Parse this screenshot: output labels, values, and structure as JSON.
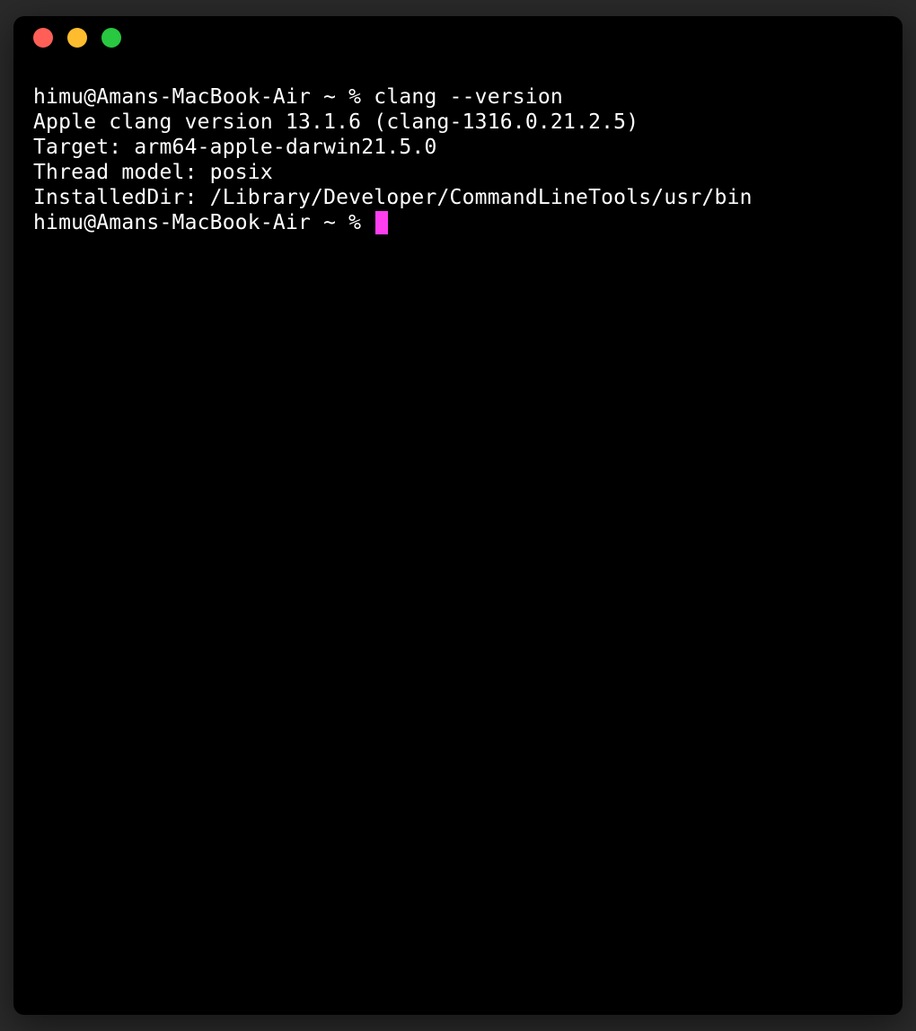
{
  "window": {
    "controls": {
      "close": "close",
      "minimize": "minimize",
      "maximize": "maximize"
    }
  },
  "terminal": {
    "lines": [
      "himu@Amans-MacBook-Air ~ % clang --version",
      "Apple clang version 13.1.6 (clang-1316.0.21.2.5)",
      "Target: arm64-apple-darwin21.5.0",
      "Thread model: posix",
      "InstalledDir: /Library/Developer/CommandLineTools/usr/bin"
    ],
    "current_prompt": "himu@Amans-MacBook-Air ~ % "
  },
  "colors": {
    "cursor": "#ff3ef0",
    "close": "#ff5f57",
    "minimize": "#febc2e",
    "maximize": "#28c840"
  }
}
